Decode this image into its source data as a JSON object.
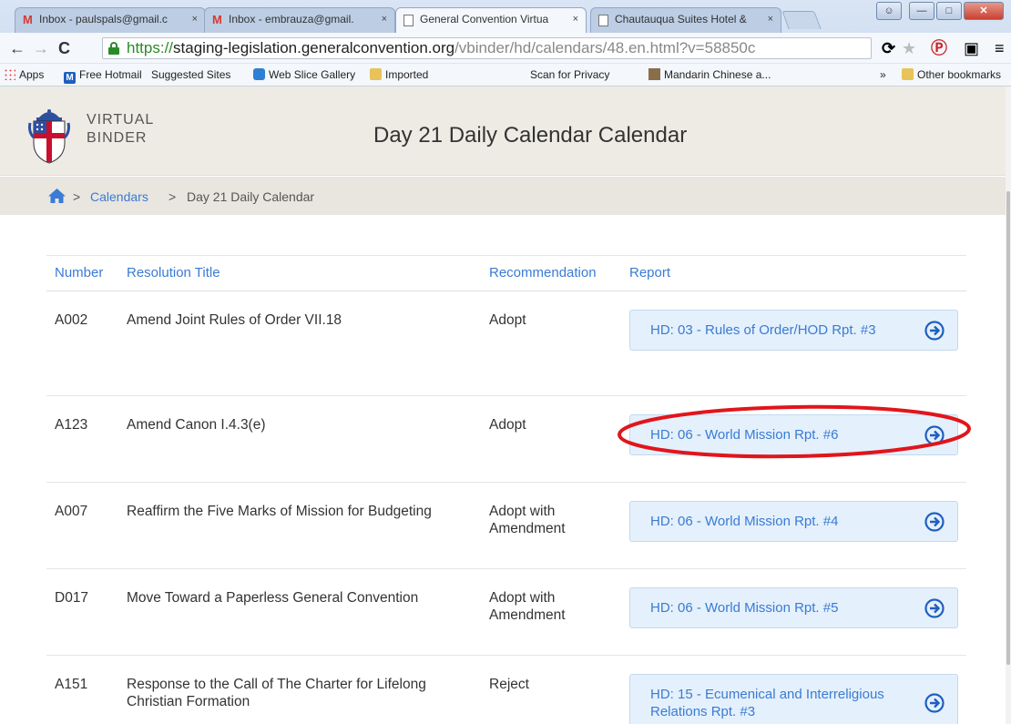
{
  "browser": {
    "tabs": [
      {
        "title": "Inbox - paulspals@gmail.c",
        "icon": "gmail-icon"
      },
      {
        "title": "Inbox - embrauza@gmail.",
        "icon": "gmail-icon"
      },
      {
        "title": "General Convention Virtua",
        "icon": "page-icon"
      },
      {
        "title": "Chautauqua Suites Hotel &",
        "icon": "page-icon"
      }
    ],
    "close_glyph": "×",
    "url_scheme": "https://",
    "url_host": "staging-legislation.generalconvention.org",
    "url_path": "/vbinder/hd/calendars/48.en.html?v=58850c",
    "bookmarks": [
      "Apps",
      "Free Hotmail",
      "Suggested Sites",
      "Web Slice Gallery",
      "Imported",
      "",
      "Scan for Privacy",
      "Mandarin Chinese a...",
      "»",
      "Other bookmarks"
    ]
  },
  "header": {
    "brand_line1": "VIRTUAL",
    "brand_line2": "BINDER",
    "title": "Day 21 Daily Calendar Calendar"
  },
  "breadcrumb": {
    "sep": ">",
    "calendars": "Calendars",
    "current": "Day 21 Daily Calendar"
  },
  "table": {
    "headers": {
      "number": "Number",
      "title": "Resolution Title",
      "recommendation": "Recommendation",
      "report": "Report"
    },
    "rows": [
      {
        "number": "A002",
        "title": "Amend Joint Rules of Order VII.18",
        "recommendation": "Adopt",
        "report": "HD: 03 - Rules of Order/HOD Rpt. #3"
      },
      {
        "number": "A123",
        "title": "Amend Canon I.4.3(e)",
        "recommendation": "Adopt",
        "report": "HD: 06 - World Mission Rpt. #6"
      },
      {
        "number": "A007",
        "title": "Reaffirm the Five Marks of Mission for Budgeting",
        "recommendation": "Adopt with Amendment",
        "report": "HD: 06 - World Mission Rpt. #4"
      },
      {
        "number": "D017",
        "title": "Move Toward a Paperless General Convention",
        "recommendation": "Adopt with Amendment",
        "report": "HD: 06 - World Mission Rpt. #5"
      },
      {
        "number": "A151",
        "title": "Response to the Call of The Charter for Lifelong Christian Formation",
        "recommendation": "Reject",
        "report": "HD: 15 - Ecumenical and Interreligious Relations Rpt. #3"
      }
    ]
  },
  "colors": {
    "link": "#3a7bd5",
    "header_bg": "#eeebe5",
    "report_bg": "#e4f0fb",
    "annotation": "#e0161b"
  }
}
